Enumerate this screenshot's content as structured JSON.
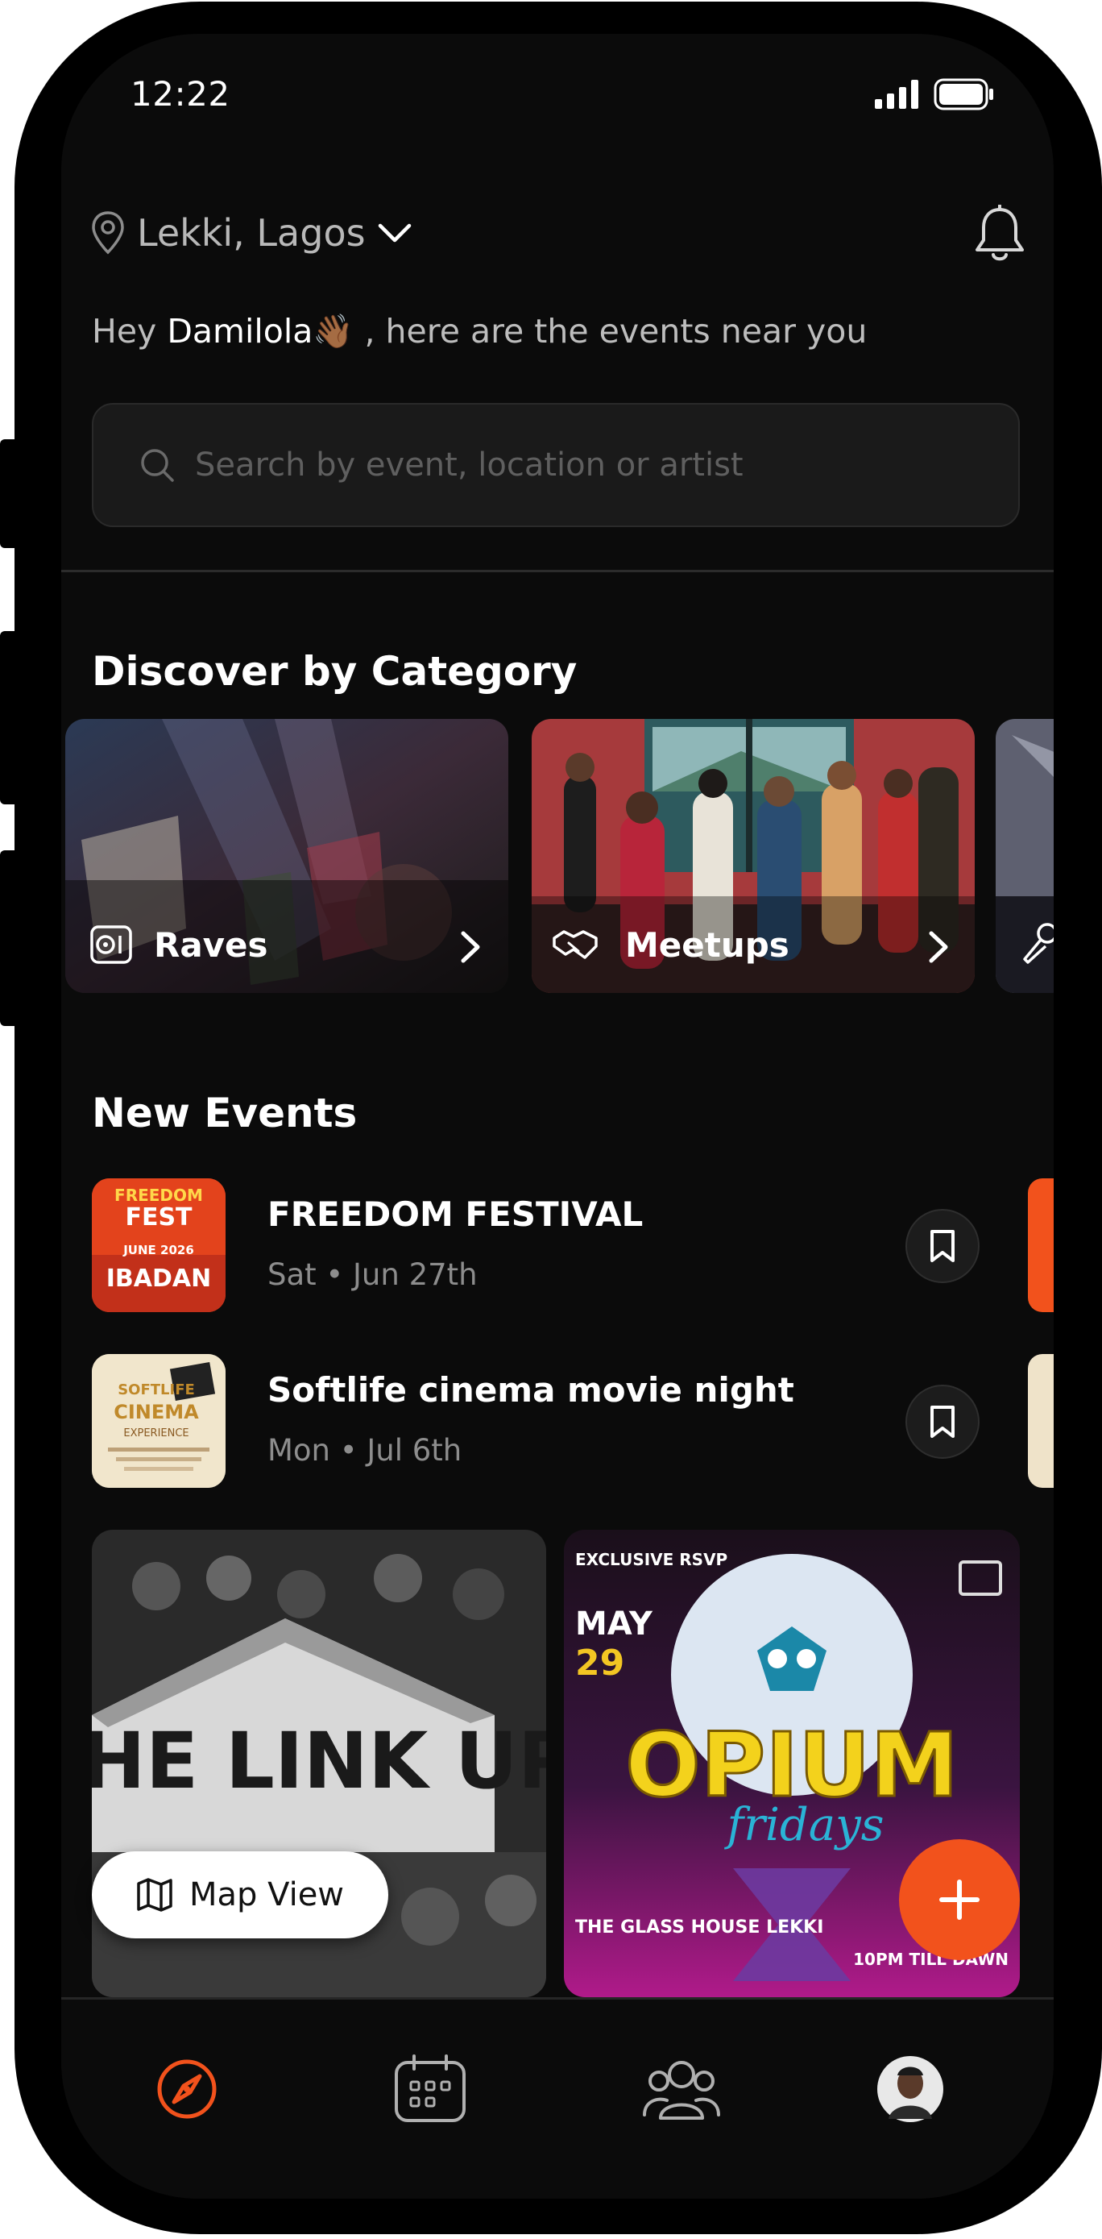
{
  "status_bar": {
    "time": "12:22"
  },
  "header": {
    "location": "Lekki, Lagos",
    "greeting_prefix": "Hey ",
    "user_name": "Damilola👋🏾",
    "greeting_suffix": " ,  here are the events near you"
  },
  "search": {
    "placeholder": "Search by event, location or artist"
  },
  "categories": {
    "title": "Discover by Category",
    "items": [
      {
        "label": "Raves",
        "icon": "speaker-icon"
      },
      {
        "label": "Meetups",
        "icon": "handshake-icon"
      },
      {
        "label": "",
        "icon": "microphone-icon"
      }
    ]
  },
  "new_events": {
    "title": "New Events",
    "items": [
      {
        "title": "FREEDOM FESTIVAL",
        "date": "Sat • Jun 27th",
        "thumb_lines": [
          "FREEDOM",
          "FEST",
          "JUNE 2026",
          "IBADAN"
        ]
      },
      {
        "title": "Softlife cinema movie night",
        "date": "Mon • Jul 6th",
        "thumb_lines": [
          "SOFTLIFE",
          "CINEMA",
          "EXPERIENCE"
        ]
      }
    ]
  },
  "posters": [
    {
      "text": "THE LINK UP"
    },
    {
      "tag": "EXCLUSIVE RSVP",
      "month": "MAY",
      "day": "29",
      "title": "OPIUM",
      "subtitle": "fridays",
      "venue": "THE GLASS HOUSE LEKKI",
      "time_text": "10PM TILL DAWN"
    }
  ],
  "map_view": {
    "label": "Map View"
  },
  "bottom_nav": [
    "explore-compass-icon",
    "calendar-icon",
    "community-icon",
    "profile-avatar"
  ],
  "colors": {
    "accent": "#f2521c",
    "background": "#0b0b0b"
  }
}
